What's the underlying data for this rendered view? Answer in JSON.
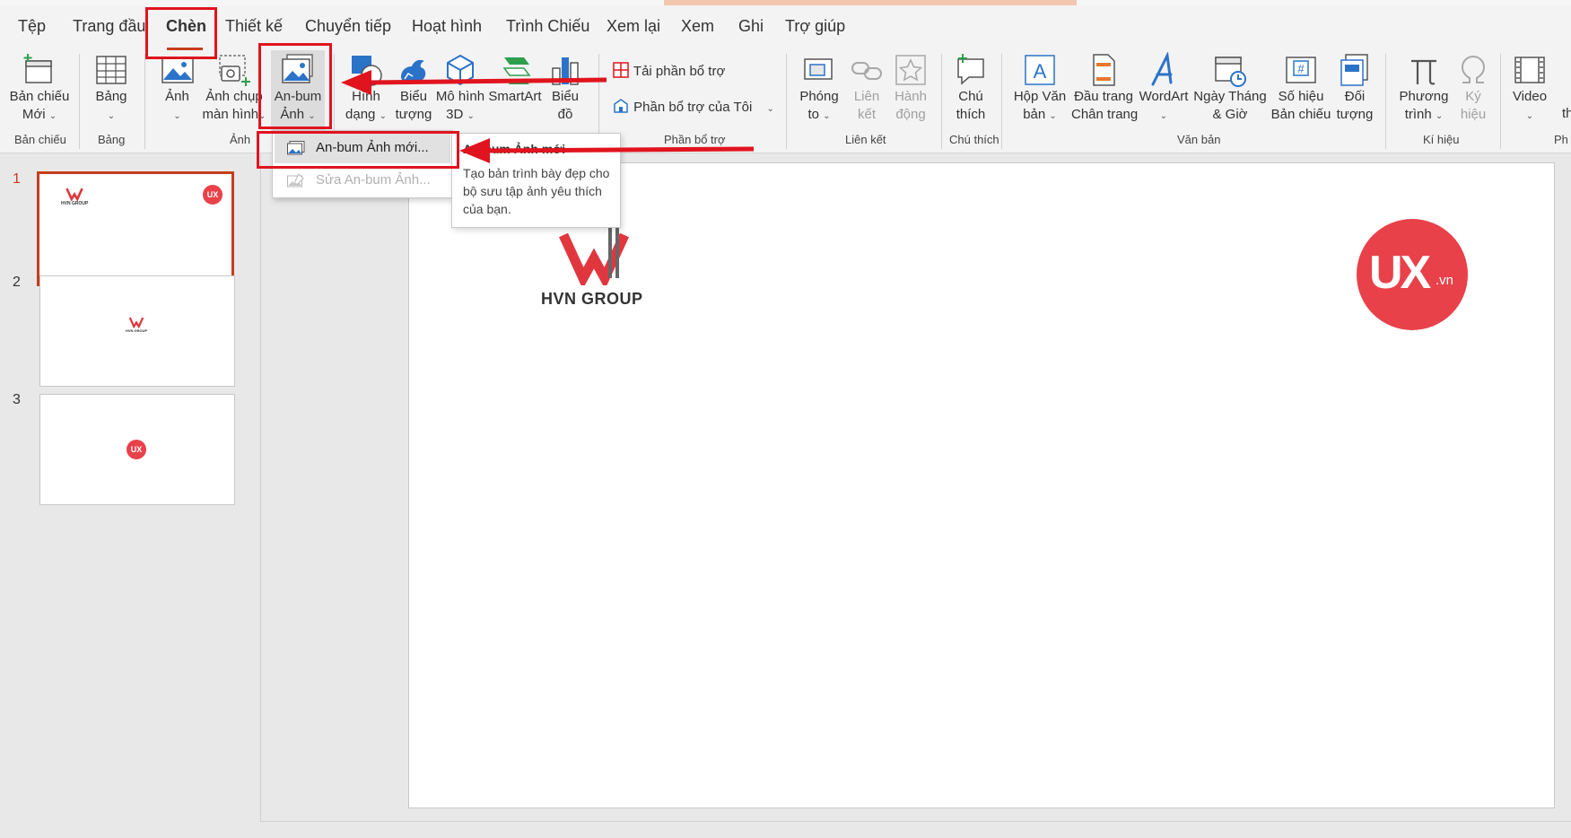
{
  "tabs": [
    "Tệp",
    "Trang đầu",
    "Chèn",
    "Thiết kế",
    "Chuyển tiếp",
    "Hoạt hình",
    "Trình Chiếu",
    "Xem lại",
    "Xem",
    "Ghi",
    "Trợ giúp"
  ],
  "ribbon": {
    "new_slide": [
      "Bản chiếu",
      "Mới"
    ],
    "table": [
      "Bảng"
    ],
    "image": [
      "Ảnh"
    ],
    "screenshot": [
      "Ảnh chụp",
      "màn hình"
    ],
    "photo_album": [
      "An-bum",
      "Ảnh"
    ],
    "shapes": [
      "Hình",
      "dạng"
    ],
    "icons": [
      "Biểu",
      "tượng"
    ],
    "models_3d": [
      "Mô hình",
      "3D"
    ],
    "smartart": [
      "SmartArt"
    ],
    "chart": [
      "Biểu",
      "đồ"
    ],
    "get_addins": "Tải phần bổ trợ",
    "my_addins": "Phần bổ trợ của Tôi",
    "zoom": [
      "Phóng",
      "to"
    ],
    "link": [
      "Liên",
      "kết"
    ],
    "action": [
      "Hành",
      "động"
    ],
    "comment": [
      "Chú",
      "thích"
    ],
    "textbox": [
      "Hộp Văn",
      "bản"
    ],
    "header_footer": [
      "Đầu trang",
      "Chân trang"
    ],
    "wordart": [
      "WordArt"
    ],
    "datetime": [
      "Ngày Tháng",
      "& Giờ"
    ],
    "slide_number": [
      "Số hiệu",
      "Bản chiếu"
    ],
    "object": [
      "Đối",
      "tượng"
    ],
    "equation": [
      "Phương",
      "trình"
    ],
    "symbol": [
      "Ký",
      "hiệu"
    ],
    "video": [
      "Video"
    ],
    "cut_end_1": "Ph",
    "cut_end_2": "th"
  },
  "group_labels": {
    "slides": "Bản chiếu",
    "tables": "Bảng",
    "images": "Ảnh",
    "addins": "Phần bổ trợ",
    "links": "Liên kết",
    "comments": "Chú thích",
    "text": "Văn bản",
    "symbols": "Kí hiệu",
    "cut": "Ph"
  },
  "dropdown": {
    "new_album": "An-bum Ảnh mới...",
    "edit_album": "Sửa An-bum Ảnh..."
  },
  "tooltip": {
    "title": "An-bum Ảnh mới",
    "body": "Tạo bản trình bày đẹp cho bộ sưu tập ảnh yêu thích của bạn."
  },
  "slides": {
    "numbers": [
      "1",
      "2",
      "3"
    ]
  },
  "slide": {
    "company": "HVN GROUP",
    "ux_logo": "UX",
    "ux_suffix": ".vn",
    "thumb_company": "HVN GROUP"
  },
  "colors": {
    "accent": "#c43e1c",
    "annotation": "#e0141e",
    "ux_red": "#e8414a",
    "ribbon_blue": "#2b73c9"
  }
}
